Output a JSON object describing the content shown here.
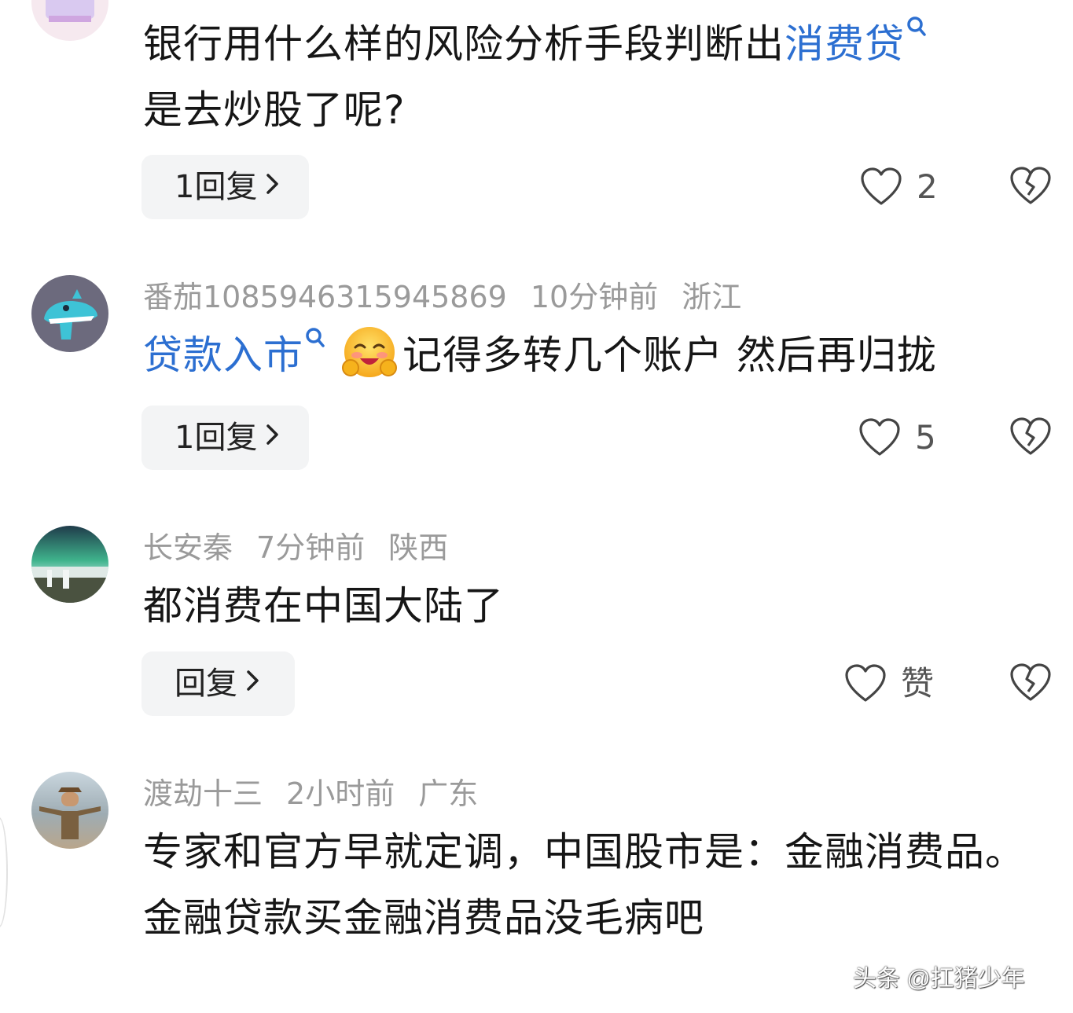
{
  "comments": [
    {
      "content_link": "消费贷",
      "content_pre": "银行用什么样的风险分析手段判断出",
      "content_post": "是去炒股了呢?",
      "reply_label": "1回复",
      "like_count": "2"
    },
    {
      "username": "番茄1085946315945869",
      "time": "10分钟前",
      "location": "浙江",
      "content_link": "贷款入市",
      "content_post": "记得多转几个账户 然后再归拢",
      "reply_label": "1回复",
      "like_count": "5"
    },
    {
      "username": "长安秦",
      "time": "7分钟前",
      "location": "陕西",
      "content": "都消费在中国大陆了",
      "reply_label": "回复",
      "like_count": "赞"
    },
    {
      "username": "渡劫十三",
      "time": "2小时前",
      "location": "广东",
      "content_line1": "专家和官方早就定调，中国股市是：金融消费品。",
      "content_line2": "金融贷款买金融消费品没毛病吧"
    }
  ],
  "watermark": "头条 @扛猪少年",
  "colors": {
    "link": "#2c6fd1",
    "meta": "#9a9a9a",
    "reply_bg": "#f3f4f5"
  },
  "icons": [
    "search-icon",
    "chevron-right-icon",
    "heart-icon",
    "broken-heart-icon",
    "hugging-face-emoji"
  ]
}
